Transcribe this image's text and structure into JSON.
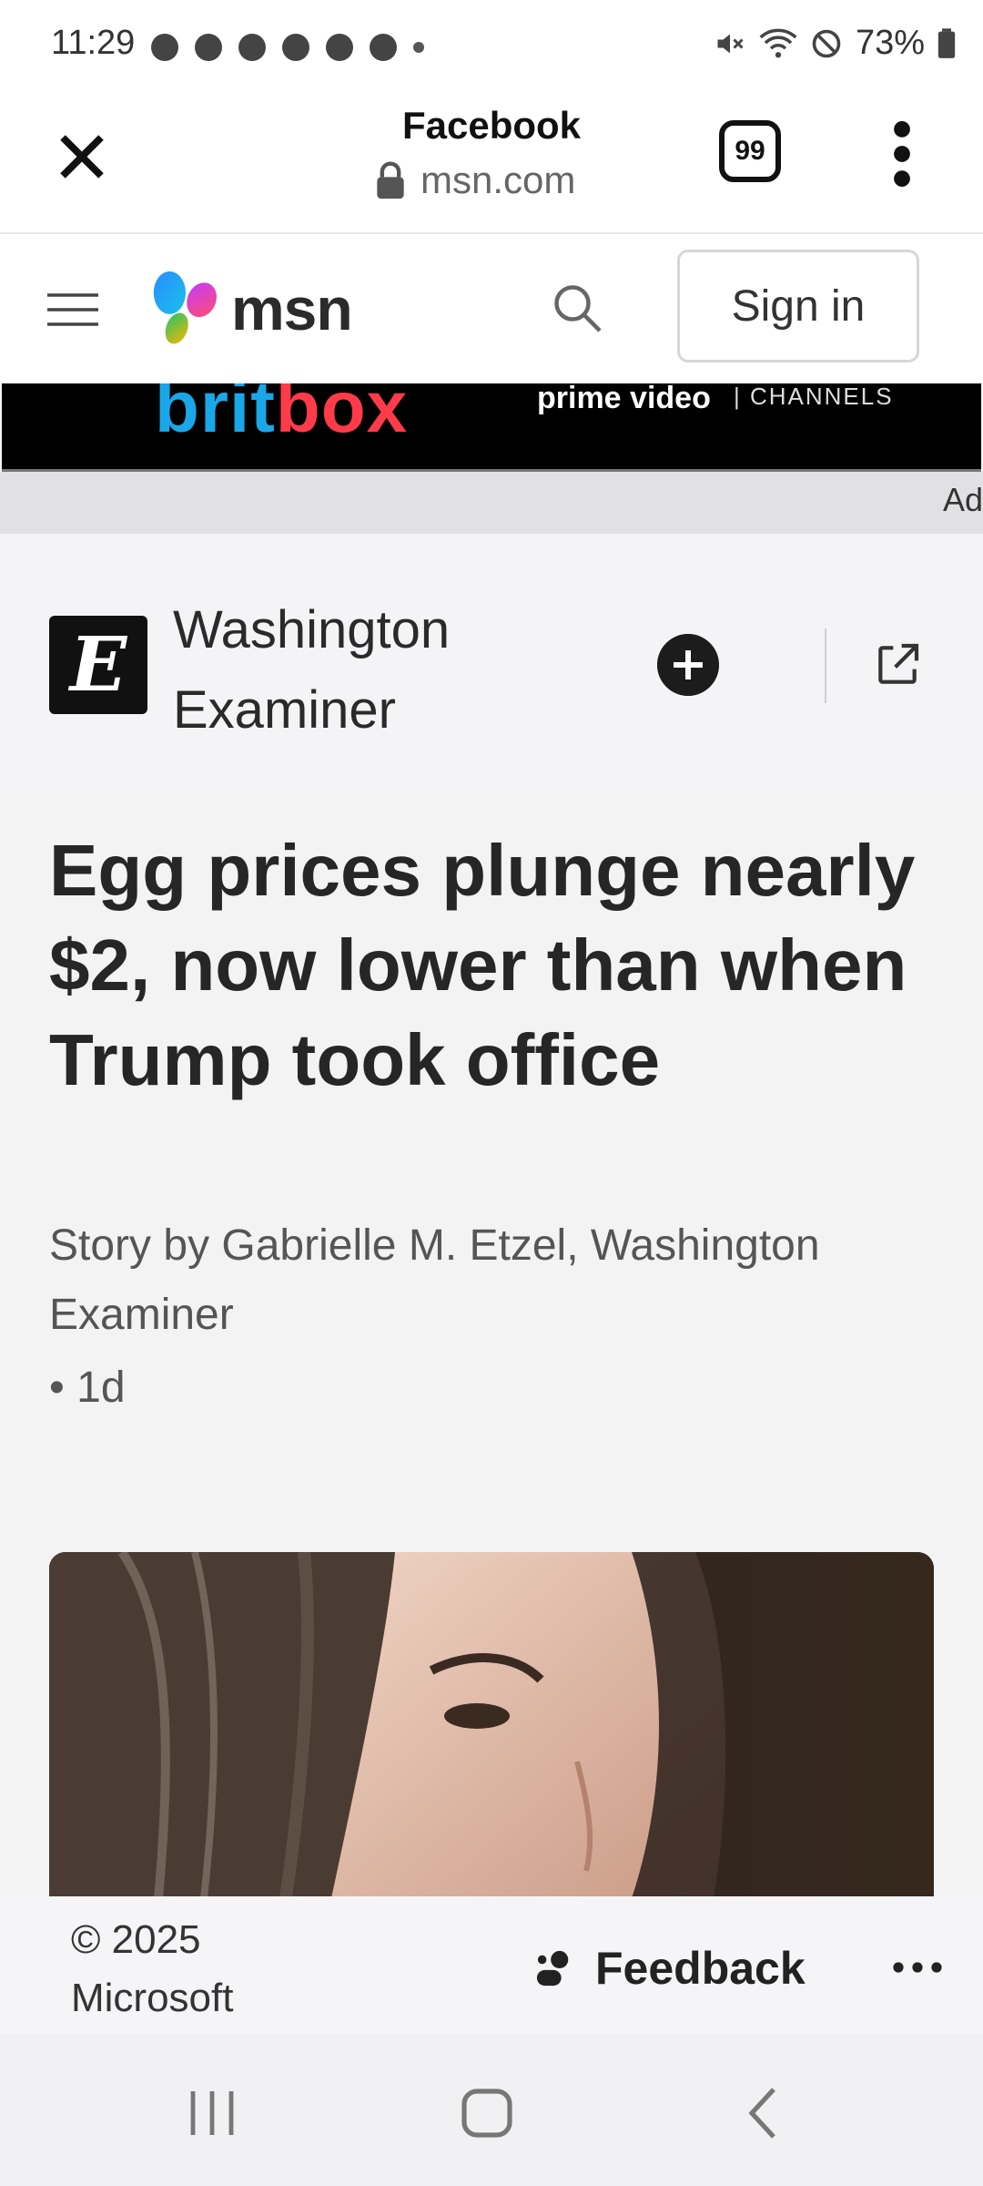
{
  "status_bar": {
    "time": "11:29",
    "battery": "73%",
    "icons": [
      "mute-icon",
      "wifi-icon",
      "do-not-disturb-icon",
      "battery-icon"
    ]
  },
  "tab": {
    "title": "Facebook",
    "url": "msn.com",
    "tab_count": "99"
  },
  "msn_header": {
    "logo_text": "msn",
    "sign_in": "Sign in"
  },
  "ad": {
    "brand": "britbox",
    "partner": "prime video",
    "partner_suffix": "| CHANNELS",
    "label": "Ad"
  },
  "publisher": {
    "logo_letter": "E",
    "name": "Washington Examiner"
  },
  "article": {
    "headline": "Egg prices plunge nearly $2, now lower than when Trump took office",
    "byline": "Story by Gabrielle M. Etzel, Washington Examiner",
    "timestamp": "• 1d"
  },
  "footer": {
    "copyright": "© 2025 Microsoft",
    "feedback": "Feedback"
  },
  "colors": {
    "britbox_blue": "#1aa7e8",
    "britbox_red": "#ff3b4a",
    "dark": "#1c1c1c"
  }
}
